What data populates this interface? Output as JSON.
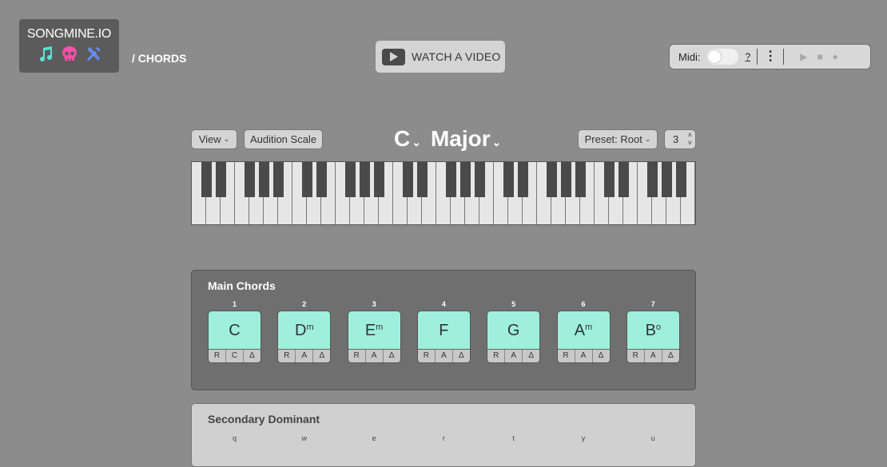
{
  "logo": {
    "text": "SONGMINE.IO",
    "icons": [
      "music-note-icon",
      "skull-icon",
      "tools-icon"
    ],
    "colors": {
      "music": "#5fe0d0",
      "skull": "#ff4fa8",
      "tools": "#6a8fff"
    }
  },
  "breadcrumb": "/ CHORDS",
  "watch_video": {
    "label": "WATCH A VIDEO",
    "icon": "play-icon"
  },
  "midi": {
    "label": "Midi:",
    "toggle_on": false,
    "help": "?",
    "menu_icon": "vertical-dots-icon",
    "controls": [
      "play-icon",
      "stop-icon",
      "record-icon"
    ]
  },
  "toolbar": {
    "view": "View",
    "audition": "Audition Scale",
    "key": "C",
    "mode": "Major",
    "preset": "Preset: Root",
    "octave": "3"
  },
  "main_chords": {
    "title": "Main Chords",
    "chords": [
      {
        "degree": "1",
        "root": "C",
        "quality": "",
        "buttons": [
          "R",
          "C",
          "Δ"
        ]
      },
      {
        "degree": "2",
        "root": "D",
        "quality": "m",
        "buttons": [
          "R",
          "A",
          "Δ"
        ]
      },
      {
        "degree": "3",
        "root": "E",
        "quality": "m",
        "buttons": [
          "R",
          "A",
          "Δ"
        ]
      },
      {
        "degree": "4",
        "root": "F",
        "quality": "",
        "buttons": [
          "R",
          "A",
          "Δ"
        ]
      },
      {
        "degree": "5",
        "root": "G",
        "quality": "",
        "buttons": [
          "R",
          "A",
          "Δ"
        ]
      },
      {
        "degree": "6",
        "root": "A",
        "quality": "m",
        "buttons": [
          "R",
          "A",
          "Δ"
        ]
      },
      {
        "degree": "7",
        "root": "B",
        "quality": "o",
        "buttons": [
          "R",
          "A",
          "Δ"
        ]
      }
    ]
  },
  "secondary_dominant": {
    "title": "Secondary Dominant",
    "keys": [
      "q",
      "w",
      "e",
      "r",
      "t",
      "y",
      "u"
    ]
  },
  "colors": {
    "chord_bg": "#9ef0dd",
    "page_bg": "#8c8c8c"
  }
}
